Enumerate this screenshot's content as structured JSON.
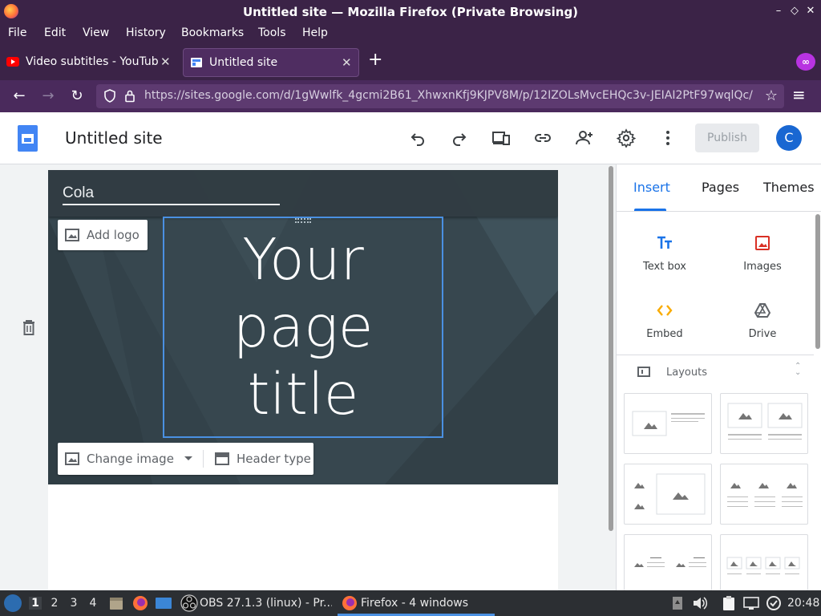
{
  "window": {
    "title": "Untitled site — Mozilla Firefox (Private Browsing)",
    "minimize": "–",
    "maximize": "◇",
    "close": "✕"
  },
  "menubar": [
    "File",
    "Edit",
    "View",
    "History",
    "Bookmarks",
    "Tools",
    "Help"
  ],
  "tabs": [
    {
      "label": "Video subtitles - YouTube",
      "active": false
    },
    {
      "label": "Untitled site",
      "active": true
    }
  ],
  "tab_close": "✕",
  "new_tab": "+",
  "private_browsing_glyph": "∞",
  "navbar": {
    "back": "←",
    "forward": "→",
    "reload": "↻",
    "url": "https://sites.google.com/d/1gWwlfk_4gcmi2B61_XhwxnKfj9KJPV8M/p/12IZOLsMvcEHQc3v-JEIAI2PtF97wqlQc/",
    "bookmark": "☆",
    "menu": "≡"
  },
  "sites_header": {
    "site_title": "Untitled site",
    "publish_label": "Publish",
    "avatar_letter": "C",
    "icons": [
      "undo-icon",
      "redo-icon",
      "preview-devices-icon",
      "link-icon",
      "share-icon",
      "settings-icon",
      "more-vert-icon"
    ]
  },
  "canvas": {
    "site_name": "Cola",
    "add_logo_label": "Add logo",
    "page_title_lines": [
      "Your",
      "page",
      "title"
    ],
    "change_image_label": "Change image",
    "header_type_label": "Header type"
  },
  "panel": {
    "tabs": [
      "Insert",
      "Pages",
      "Themes"
    ],
    "active_tab": "Insert",
    "insert_items": [
      {
        "label": "Text box",
        "icon": "text-box-icon",
        "color": "#1a73e8"
      },
      {
        "label": "Images",
        "icon": "images-icon",
        "color": "#d93025"
      },
      {
        "label": "Embed",
        "icon": "embed-icon",
        "color": "#f9ab00"
      },
      {
        "label": "Drive",
        "icon": "drive-icon",
        "color": "#5f6368"
      }
    ],
    "layouts_label": "Layouts"
  },
  "taskbar": {
    "workspaces": [
      "1",
      "2",
      "3",
      "4"
    ],
    "obs_task": "OBS 27.1.3 (linux) - Pr...",
    "firefox_task": "Firefox - 4 windows",
    "clock": "20:48"
  },
  "colors": {
    "firefox_private_purple": "#3b2347",
    "google_blue": "#1a73e8",
    "header_slate": "#37474f"
  }
}
